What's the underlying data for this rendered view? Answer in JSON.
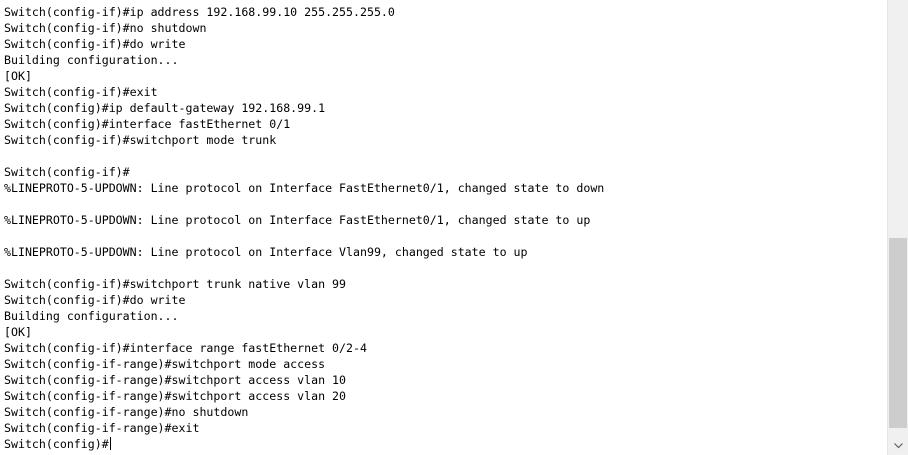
{
  "terminal": {
    "lines": [
      "Switch(config-if)#ip address 192.168.99.10 255.255.255.0",
      "Switch(config-if)#no shutdown",
      "Switch(config-if)#do write",
      "Building configuration...",
      "[OK]",
      "Switch(config-if)#exit",
      "Switch(config)#ip default-gateway 192.168.99.1",
      "Switch(config)#interface fastEthernet 0/1",
      "Switch(config-if)#switchport mode trunk",
      "",
      "Switch(config-if)#",
      "%LINEPROTO-5-UPDOWN: Line protocol on Interface FastEthernet0/1, changed state to down",
      "",
      "%LINEPROTO-5-UPDOWN: Line protocol on Interface FastEthernet0/1, changed state to up",
      "",
      "%LINEPROTO-5-UPDOWN: Line protocol on Interface Vlan99, changed state to up",
      "",
      "Switch(config-if)#switchport trunk native vlan 99",
      "Switch(config-if)#do write",
      "Building configuration...",
      "[OK]",
      "Switch(config-if)#interface range fastEthernet 0/2-4",
      "Switch(config-if-range)#switchport mode access",
      "Switch(config-if-range)#switchport access vlan 10",
      "Switch(config-if-range)#switchport access vlan 20",
      "Switch(config-if-range)#no shutdown",
      "Switch(config-if-range)#exit"
    ],
    "prompt": "Switch(config)#"
  },
  "scrollbar": {
    "down_arrow_icon": "chevron-down-icon",
    "position_fraction": 1.0
  },
  "colors": {
    "background": "#ffffff",
    "text": "#000000",
    "scrollbar_track": "#f0f0f0",
    "scrollbar_thumb": "#cdcdcd"
  }
}
